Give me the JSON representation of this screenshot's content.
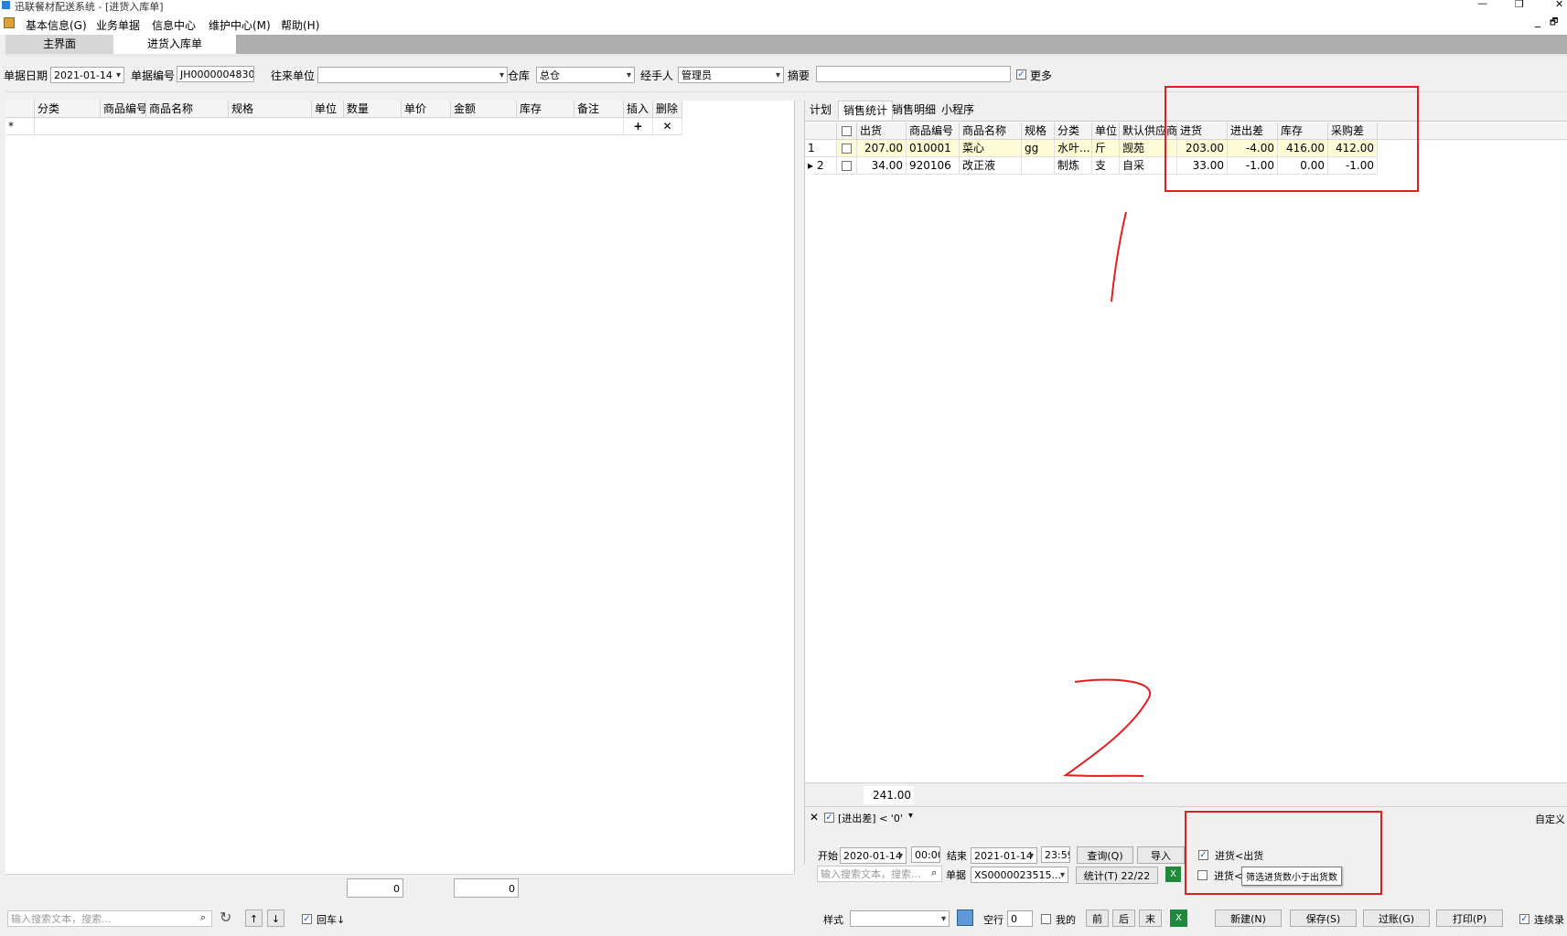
{
  "window": {
    "title": "迅联餐材配送系统 - [进货入库单]",
    "min": "—",
    "restore": "❐",
    "close": "✕",
    "inner_min": "_",
    "inner_restore": "🗗"
  },
  "menu": [
    "基本信息(G)",
    "业务单据",
    "信息中心",
    "维护中心(M)",
    "帮助(H)"
  ],
  "tabs": [
    {
      "label": "主界面"
    },
    {
      "label": "进货入库单"
    }
  ],
  "form": {
    "date_label": "单据日期",
    "date_value": "2021-01-14",
    "no_label": "单据编号",
    "no_value": "JH0000004830",
    "partner_label": "往来单位",
    "partner_value": "",
    "warehouse_label": "仓库",
    "warehouse_value": "总仓",
    "handler_label": "经手人",
    "handler_value": "管理员",
    "summary_label": "摘要",
    "summary_value": "",
    "more_label": "更多",
    "more_checked": true
  },
  "left_grid": {
    "columns": [
      "分类",
      "商品编号",
      "商品名称",
      "规格",
      "单位",
      "数量",
      "单价",
      "金额",
      "库存",
      "备注",
      "插入",
      "删除"
    ],
    "new_row_marker": "*",
    "insert_icon": "+",
    "delete_icon": "✕",
    "total_qty": "0",
    "total_amount": "0"
  },
  "right_tabs": [
    "计划",
    "销售统计",
    "销售明细",
    "小程序"
  ],
  "right_grid": {
    "columns": [
      "出货",
      "商品编号",
      "商品名称",
      "规格",
      "分类",
      "单位",
      "默认供应商",
      "进货",
      "进出差",
      "库存",
      "采购差"
    ],
    "rows": [
      {
        "idx": "1",
        "marker": "",
        "out": "207.00",
        "code": "010001",
        "name": "菜心",
        "spec": "gg",
        "cat": "水叶...",
        "unit": "斤",
        "supplier": "觊苑",
        "in": "203.00",
        "diff": "-4.00",
        "stock": "416.00",
        "pdiff": "412.00"
      },
      {
        "idx": "2",
        "marker": "▸",
        "out": "34.00",
        "code": "920106",
        "name": "改正液",
        "spec": "",
        "cat": "制炼",
        "unit": "支",
        "supplier": "自采",
        "in": "33.00",
        "diff": "-1.00",
        "stock": "0.00",
        "pdiff": "-1.00"
      }
    ],
    "total_out": "241.00"
  },
  "filter": {
    "text": "[进出差] < '0'",
    "customize": "自定义"
  },
  "query": {
    "start_label": "开始",
    "start_date": "2020-01-14",
    "start_time": "00:00",
    "end_label": "结束",
    "end_date": "2021-01-14",
    "end_time": "23:59",
    "query_btn": "查询(Q)",
    "import_btn": "导入",
    "search_placeholder": "输入搜索文本，搜索...",
    "doc_label": "单据",
    "doc_value": "XS0000023515...",
    "stats_btn": "统计(T) 22/22",
    "opt1_label": "进货<出货",
    "opt1_checked": true,
    "opt2_label": "进货<",
    "opt2_checked": false,
    "tooltip": "筛选进货数小于出货数"
  },
  "bottom": {
    "search_placeholder": "输入搜索文本，搜索...",
    "enter_label": "回车↓",
    "enter_checked": true,
    "style_label": "样式",
    "style_value": "",
    "blank_label": "空行",
    "blank_value": "0",
    "mine_label": "我的",
    "nav": [
      "前",
      "后",
      "末"
    ],
    "new_btn": "新建(N)",
    "save_btn": "保存(S)",
    "post_btn": "过账(G)",
    "print_btn": "打印(P)",
    "continue_label": "连续录"
  },
  "annotations": {
    "mark1": "1",
    "mark2": "2",
    "color": "#e02020"
  },
  "colors": {
    "selected_row": "#fffbd6",
    "tab_active": "#ffffff",
    "tabstrip": "#adadad"
  }
}
